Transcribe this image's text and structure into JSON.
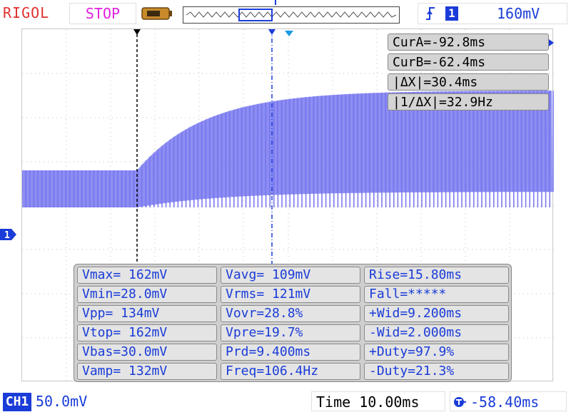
{
  "header": {
    "brand": "RIGOL",
    "run_state": "STOP",
    "trigger_channel": "1",
    "trigger_level": "160mV"
  },
  "cursors": {
    "cur_a": "CurA=-92.8ms",
    "cur_b": "CurB=-62.4ms",
    "delta_x": "|ΔX|=30.4ms",
    "inv_delta_x": "|1/ΔX|=32.9Hz"
  },
  "measurements": {
    "rows": [
      [
        "Vmax= 162mV",
        "Vavg= 109mV",
        "Rise=15.80ms"
      ],
      [
        "Vmin=28.0mV",
        "Vrms= 121mV",
        "Fall=*****"
      ],
      [
        "Vpp= 134mV",
        "Vovr=28.8%",
        "+Wid=9.200ms"
      ],
      [
        "Vtop= 162mV",
        "Vpre=19.7%",
        "-Wid=2.000ms"
      ],
      [
        "Vbas=30.0mV",
        "Prd=9.400ms",
        "+Duty=97.9%"
      ],
      [
        "Vamp= 132mV",
        "Freq=106.4Hz",
        "-Duty=21.3%"
      ]
    ]
  },
  "footer": {
    "channel_label": "CH1",
    "channel_scale": "50.0mV",
    "timebase": "Time 10.00ms",
    "delay": "-58.40ms"
  },
  "channel_marker": "1",
  "colors": {
    "trace": "#7b7bf0",
    "channel": "#1a3cd8",
    "brand": "#e03030",
    "stop": "#e020e0"
  }
}
